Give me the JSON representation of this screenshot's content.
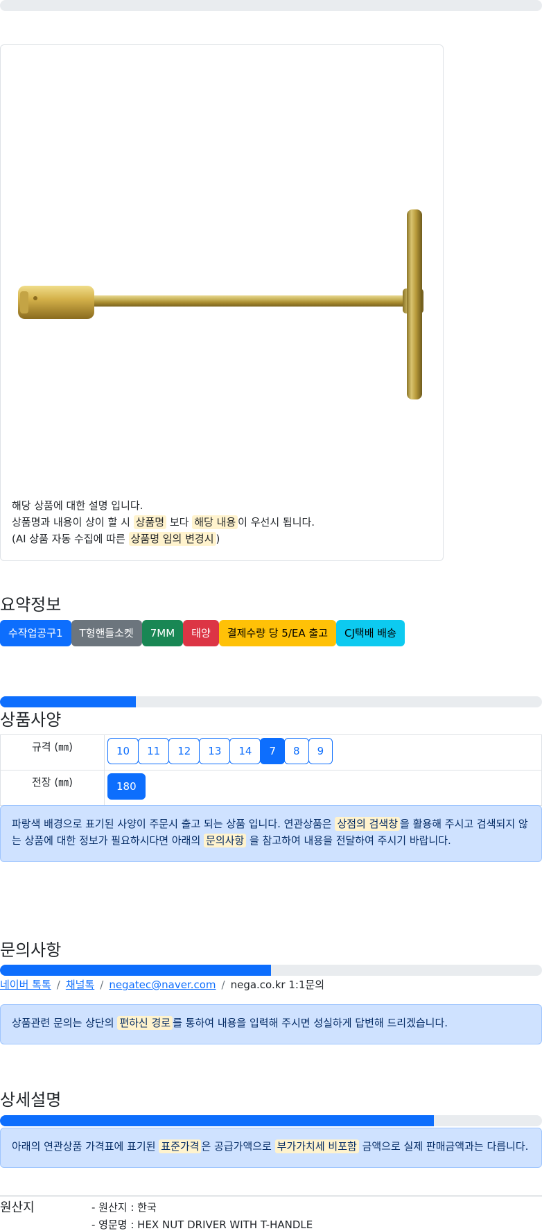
{
  "top_progress_percent": 0,
  "product_card": {
    "image_name": "t-handle-hex-nut-driver",
    "desc_line1": "해당 상품에 대한 설명 입니다.",
    "desc_line2_a": "상품명과 내용이 상이 할 시 ",
    "desc_line2_hl1": "상품명",
    "desc_line2_b": " 보다 ",
    "desc_line2_hl2": "해당 내용",
    "desc_line2_c": "이 우선시 됩니다.",
    "desc_line3_a": "(AI 상품 자동 수집에 따른 ",
    "desc_line3_hl": "상품명 임의 변경시",
    "desc_line3_b": ")"
  },
  "summary": {
    "title": "요약정보",
    "badges": [
      {
        "label": "수작업공구1",
        "color": "#0d6efd",
        "text_color": "#ffffff"
      },
      {
        "label": "T형핸들소켓",
        "color": "#6c757d",
        "text_color": "#ffffff"
      },
      {
        "label": "7MM",
        "color": "#198754",
        "text_color": "#ffffff"
      },
      {
        "label": "태양",
        "color": "#dc3545",
        "text_color": "#ffffff"
      },
      {
        "label": "결제수량 당 5/EA 출고",
        "color": "#ffc107",
        "text_color": "#000000"
      },
      {
        "label": "CJ택배 배송",
        "color": "#0dcaf0",
        "text_color": "#000000"
      }
    ]
  },
  "spec": {
    "progress_percent": 25,
    "title": "상품사양",
    "rows": [
      {
        "label": "규격 (㎜)",
        "options": [
          "10",
          "11",
          "12",
          "13",
          "14",
          "7",
          "8",
          "9"
        ],
        "selected": "7"
      },
      {
        "label": "전장 (㎜)",
        "options": [
          "180"
        ],
        "selected": "180"
      }
    ],
    "notice_a": "파랑색 배경으로 표기된 사양이 주문시 출고 되는 상품 입니다. 연관상품은 ",
    "notice_hl1": "상점의 검색창",
    "notice_b": "을 활용해 주시고 검색되지 않는 상품에 대한 정보가 필요하시다면 아래의 ",
    "notice_hl2": "문의사항",
    "notice_c": " 을 참고하여 내용을 전달하여 주시기 바랍니다."
  },
  "inquiry": {
    "title": "문의사항",
    "progress_percent": 50,
    "links": [
      "네이버 톡톡",
      "채널톡",
      "negatec@naver.com"
    ],
    "plain": "nega.co.kr 1:1문의",
    "separator": "/",
    "notice_a": "상품관련 문의는 상단의 ",
    "notice_hl": "편하신 경로",
    "notice_b": "를 통하여 내용을 입력해 주시면 성실하게 답변해 드리겠습니다."
  },
  "detail": {
    "title": "상세설명",
    "progress_percent": 80,
    "notice_a": "아래의 연관상품 가격표에 표기된 ",
    "notice_hl1": "표준가격",
    "notice_b": "은 공급가액으로 ",
    "notice_hl2": "부가가치세 비포함",
    "notice_c": " 금액으로 실제 판매금액과는 다릅니다."
  },
  "origin": {
    "label": "원산지",
    "items": [
      "- 원산지 : 한국",
      "- 영문명 : HEX NUT DRIVER WITH T-HANDLE"
    ]
  }
}
